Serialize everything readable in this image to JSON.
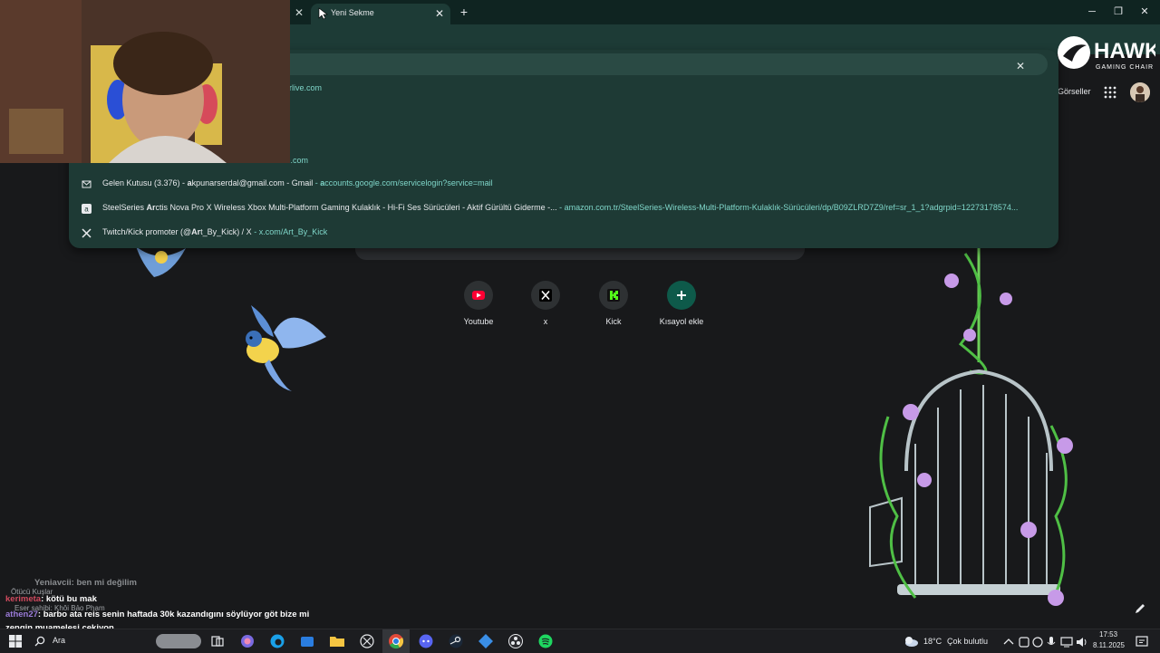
{
  "browser": {
    "active_tab_title": "Yeni Sekme",
    "tab_close_glyph": "✕",
    "new_tab_glyph": "+",
    "minimize_glyph": "─",
    "restore_glyph": "❐",
    "close_window_glyph": "✕"
  },
  "omnibox": {
    "clear_glyph": "✕",
    "partial_suggestions": [
      "rlive.com",
      "me.com"
    ],
    "suggestions": [
      {
        "icon": "gmail-icon",
        "title_pre": "Gelen Kutusu (3.376) - ",
        "title_bold": "a",
        "title_post": "kpunarserdal@gmail.com - Gmail",
        "url_sep": " - ",
        "url_bold": "a",
        "url_post": "ccounts.google.com/servicelogin?service=mail"
      },
      {
        "icon": "amazon-icon",
        "title_pre": "SteelSeries ",
        "title_bold": "Ar",
        "title_post": "ctis Nova Pro X Wireless Xbox Multi-Platform Gaming Kulaklık - Hi-Fi Ses Sürücüleri - Aktif Gürültü Giderme -...",
        "url_sep": "  - ",
        "url_bold": "",
        "url_post": "amazon.com.tr/SteelSeries-Wireless-Multi-Platform-Kulaklık-Sürücüleri/dp/B09ZLRD7Z9/ref=sr_1_1?adgrpid=12273178574..."
      },
      {
        "icon": "x-icon",
        "title_pre": "Twitch/Kick promoter (@",
        "title_bold": "Ar",
        "title_post": "t_By_Kick) / X",
        "url_sep": " - ",
        "url_bold": "",
        "url_post": "x.com/Art_By_Kick"
      }
    ]
  },
  "header": {
    "images_link": "Görseller"
  },
  "shortcuts": [
    {
      "label": "Youtube",
      "icon": "youtube-icon",
      "color": "#ff0033"
    },
    {
      "label": "x",
      "icon": "x-icon",
      "color": "#ffffff"
    },
    {
      "label": "Kick",
      "icon": "kick-icon",
      "color": "#53fc18"
    },
    {
      "label": "Kısayol ekle",
      "icon": "plus-icon",
      "color": "#ffffff"
    }
  ],
  "logo": {
    "brand": "HAWK",
    "sub": "GAMING CHAIR"
  },
  "chat": {
    "line1_user": "Yeniavcii",
    "line1_text": ": ben mi değilim",
    "line2_user": "kerimeta",
    "line2_text": ": kötü bu mak",
    "overlay_a": "Ötücü Kuşlar",
    "overlay_b": "Eser sahibi: Khôi Bảo Phạm",
    "line3_user": "athen27",
    "line3_text": ": barbo ata reis senin haftada 30k kazandıgını söylüyor göt bize mi",
    "line4_text": "zengin muamelesi cekiyon"
  },
  "taskbar": {
    "search_label": "Ara",
    "weather_temp": "18°C",
    "weather_desc": "Çok bulutlu",
    "time": "17:53",
    "date": "8.11.2025"
  },
  "colors": {
    "accent_teal": "#7fd6c9",
    "chrome_dark": "#0f2421",
    "chrome_toolbar": "#1d3b36"
  }
}
